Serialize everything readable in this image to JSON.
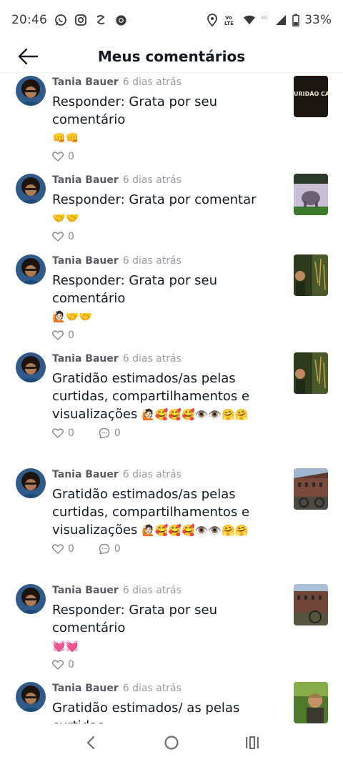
{
  "status_bar": {
    "time": "20:46",
    "battery": "33%",
    "left_icons": [
      "whatsapp-icon",
      "instagram-icon",
      "app-icon",
      "chrome-icon"
    ],
    "right_icons": [
      "location-icon",
      "volte-icon",
      "wifi-icon",
      "4g-icon",
      "signal-icon",
      "battery-icon"
    ]
  },
  "header": {
    "title": "Meus comentários",
    "back_icon": "arrow-left-icon"
  },
  "comments": [
    {
      "author": "Tania Bauer",
      "time": "6 dias atrás",
      "text": "Responder: Grata por seu comentário",
      "emojis": "👊👊",
      "likes": "0",
      "replies": null,
      "thumb_text": "URIDÃO CA"
    },
    {
      "author": "Tania Bauer",
      "time": "6 dias atrás",
      "text": "Responder: Grata por comentar",
      "emojis": "🤝🤝",
      "likes": "0",
      "replies": null,
      "thumb_text": ""
    },
    {
      "author": "Tania Bauer",
      "time": "6 dias atrás",
      "text": "Responder: Grata por seu comentário",
      "emojis": "🙋🏻🤝🤝",
      "likes": "0",
      "replies": null,
      "thumb_text": ""
    },
    {
      "author": "Tania Bauer",
      "time": "6 dias atrás",
      "text": "Gratidão estimados/as pelas curtidas, compartilhamentos e visualizações",
      "emojis": "🙋🏻🥰🥰🥰👁️👁️🤗🤗",
      "likes": "0",
      "replies": "0",
      "thumb_text": ""
    },
    {
      "author": "Tania Bauer",
      "time": "6 dias atrás",
      "text": "Gratidão estimados/as pelas curtidas, compartilhamentos e visualizações",
      "emojis": "🙋🏻🥰🥰🥰👁️👁️🤗🤗",
      "likes": "0",
      "replies": "0",
      "thumb_text": ""
    },
    {
      "author": "Tania Bauer",
      "time": "6 dias atrás",
      "text": "Responder: Grata por seu comentário",
      "emojis": "💓💓",
      "likes": "0",
      "replies": null,
      "thumb_text": ""
    },
    {
      "author": "Tania Bauer",
      "time": "6 dias atrás",
      "text": "Gratidão estimados/ as pelas curtidas,",
      "emojis": "",
      "likes": "",
      "replies": null,
      "thumb_text": ""
    }
  ],
  "nav_bar": {
    "icons": [
      "back-nav-icon",
      "home-nav-icon",
      "recents-nav-icon"
    ]
  }
}
